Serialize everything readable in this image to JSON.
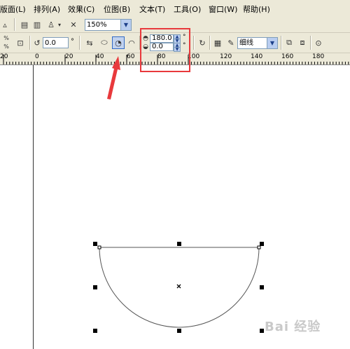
{
  "menu": {
    "items": [
      "版面(L)",
      "排列(A)",
      "效果(C)",
      "位图(B)",
      "文本(T)",
      "工具(O)",
      "窗口(W)",
      "帮助(H)"
    ]
  },
  "toolbar": {
    "zoom_value": "150%",
    "rotation_value": "0.0",
    "rotation_unit": "°",
    "start_angle": "180.0",
    "end_angle": "0.0",
    "angle_unit": "°",
    "outline_width": "细线"
  },
  "ruler": {
    "labels": [
      "20",
      "0",
      "20",
      "40",
      "60",
      "80",
      "100",
      "120",
      "140",
      "160",
      "180"
    ]
  },
  "watermark": "Bai 经验",
  "colors": {
    "ui_bg": "#ece9d8",
    "highlight": "#e8393c",
    "arrow": "#e8393c"
  }
}
